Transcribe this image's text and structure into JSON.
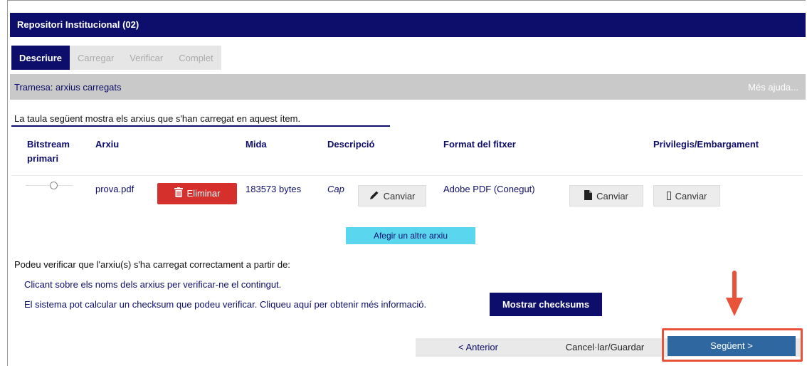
{
  "header": {
    "title": "Repositori Institucional (02)"
  },
  "tabs": [
    {
      "label": "Descriure",
      "active": true
    },
    {
      "label": "Carregar",
      "active": false
    },
    {
      "label": "Verificar",
      "active": false
    },
    {
      "label": "Complet",
      "active": false
    }
  ],
  "section": {
    "title": "Tramesa: arxius carregats",
    "help_link": "Més ajuda..."
  },
  "intro": "La taula següent mostra els arxius que s'han carregat en aquest ítem.",
  "table": {
    "headers": {
      "primary_line1": "Bitstream",
      "primary_line2": "primari",
      "file": "Arxiu",
      "size": "Mida",
      "description": "Descripció",
      "format": "Format del fitxer",
      "privileges": "Privilegis/Embargament"
    },
    "rows": [
      {
        "file": "prova.pdf",
        "delete_label": "Eliminar",
        "size": "183573 bytes",
        "description": "Cap",
        "change_description_label": "Canviar",
        "format": "Adobe PDF (Conegut)",
        "change_format_label": "Canviar",
        "change_privileges_label": "Canviar"
      }
    ]
  },
  "add_file_label": "Afegir un altre arxiu",
  "verify": {
    "intro": "Podeu verificar que l'arxiu(s) s'ha carregat correctament a partir de:",
    "item1": "Clicant sobre els noms dels arxius per verificar-ne el contingut.",
    "item2": "El sistema pot calcular un checksum que podeu verificar. Cliqueu aquí per obtenir més informació.",
    "checksums_label": "Mostrar checksums"
  },
  "nav": {
    "previous_label": "< Anterior",
    "cancel_label": "Cancel·lar/Guardar",
    "next_label": "Següent >"
  },
  "colors": {
    "primary": "#0d0d6b",
    "danger": "#d6302d",
    "accent": "#5ad7ef",
    "next": "#2f67a0",
    "highlight": "#e8533a"
  },
  "icons": {
    "delete": "trash-icon",
    "edit": "pencil-icon",
    "file": "file-icon",
    "privileges": "placeholder-icon",
    "annotation": "arrow-down-icon"
  }
}
